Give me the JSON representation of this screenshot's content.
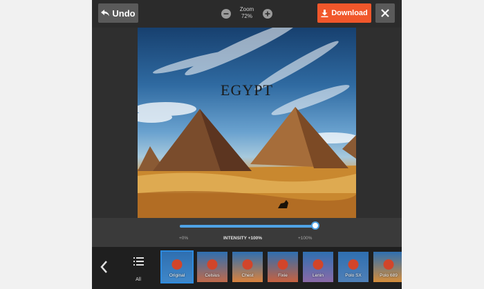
{
  "toolbar": {
    "undo_label": "Undo",
    "zoom_label": "Zoom",
    "zoom_value": "72%",
    "download_label": "Download"
  },
  "photo": {
    "title": "EGYPT"
  },
  "intensity": {
    "label": "INTENSITY +100%",
    "min_label": "+0%",
    "max_label": "+100%",
    "value_fraction": 1.0
  },
  "filters": {
    "all_label": "All",
    "selected": "Original",
    "items": [
      {
        "label": "Original",
        "tint": "#3f87c9"
      },
      {
        "label": "Celsius",
        "tint": "#c06a4b"
      },
      {
        "label": "Chest",
        "tint": "#d9823d"
      },
      {
        "label": "Fixie",
        "tint": "#c7613f"
      },
      {
        "label": "Lenin",
        "tint": "#8a6aa8"
      },
      {
        "label": "Polo SX",
        "tint": "#4f80b8"
      },
      {
        "label": "Polo 689",
        "tint": "#d58d3a"
      }
    ]
  },
  "colors": {
    "accent": "#f1572b",
    "slider": "#4fa3e6",
    "selected_outline": "#2d8be0"
  }
}
